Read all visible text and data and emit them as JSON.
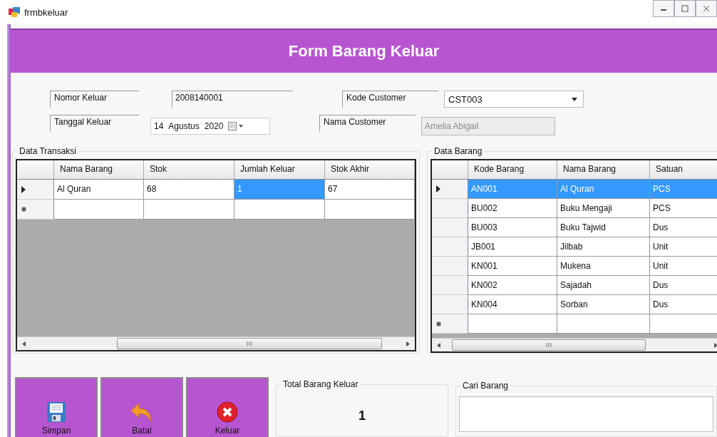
{
  "window": {
    "title": "frmbkeluar"
  },
  "header": {
    "title": "Form Barang Keluar"
  },
  "fields": {
    "nomor_keluar": {
      "label": "Nomor Keluar",
      "value": "2008140001"
    },
    "tanggal_keluar": {
      "label": "Tanggal Keluar",
      "day": "14",
      "month": "Agustus",
      "year": "2020"
    },
    "kode_customer": {
      "label": "Kode Customer",
      "value": "CST003"
    },
    "nama_customer": {
      "label": "Nama Customer",
      "value": "Amelia Abigail",
      "disabled": true
    }
  },
  "transaksi": {
    "title": "Data Transaksi",
    "columns": [
      "Nama Barang",
      "Stok",
      "Jumlah Keluar",
      "Stok Akhir"
    ],
    "rows": [
      {
        "kind": "data",
        "current": true,
        "cells": [
          {
            "text": "Al Quran",
            "selected": false
          },
          {
            "text": "68",
            "selected": false
          },
          {
            "text": "1",
            "selected": true
          },
          {
            "text": "67",
            "selected": false
          }
        ]
      },
      {
        "kind": "new",
        "current": false
      }
    ]
  },
  "barang": {
    "title": "Data Barang",
    "columns": [
      "Kode Barang",
      "Nama Barang",
      "Satuan"
    ],
    "rows": [
      {
        "kind": "data",
        "current": true,
        "selected": true,
        "cells": [
          "AN001",
          "Al Quran",
          "PCS"
        ]
      },
      {
        "kind": "data",
        "current": false,
        "selected": false,
        "cells": [
          "BU002",
          "Buku Mengaji",
          "PCS"
        ]
      },
      {
        "kind": "data",
        "current": false,
        "selected": false,
        "cells": [
          "BU003",
          "Buku Tajwid",
          "Dus"
        ]
      },
      {
        "kind": "data",
        "current": false,
        "selected": false,
        "cells": [
          "JB001",
          "Jilbab",
          "Unit"
        ]
      },
      {
        "kind": "data",
        "current": false,
        "selected": false,
        "cells": [
          "KN001",
          "Mukena",
          "Unit"
        ]
      },
      {
        "kind": "data",
        "current": false,
        "selected": false,
        "cells": [
          "KN002",
          "Sajadah",
          "Dus"
        ]
      },
      {
        "kind": "data",
        "current": false,
        "selected": false,
        "cells": [
          "KN004",
          "Sorban",
          "Dus"
        ]
      },
      {
        "kind": "new",
        "current": false,
        "selected": false
      }
    ]
  },
  "buttons": [
    {
      "kind": "save",
      "label": "Simpan"
    },
    {
      "kind": "undo",
      "label": "Batal"
    },
    {
      "kind": "exit",
      "label": "Keluar"
    }
  ],
  "total": {
    "title": "Total Barang Keluar",
    "value": "1"
  },
  "search": {
    "title": "Cari Barang"
  }
}
